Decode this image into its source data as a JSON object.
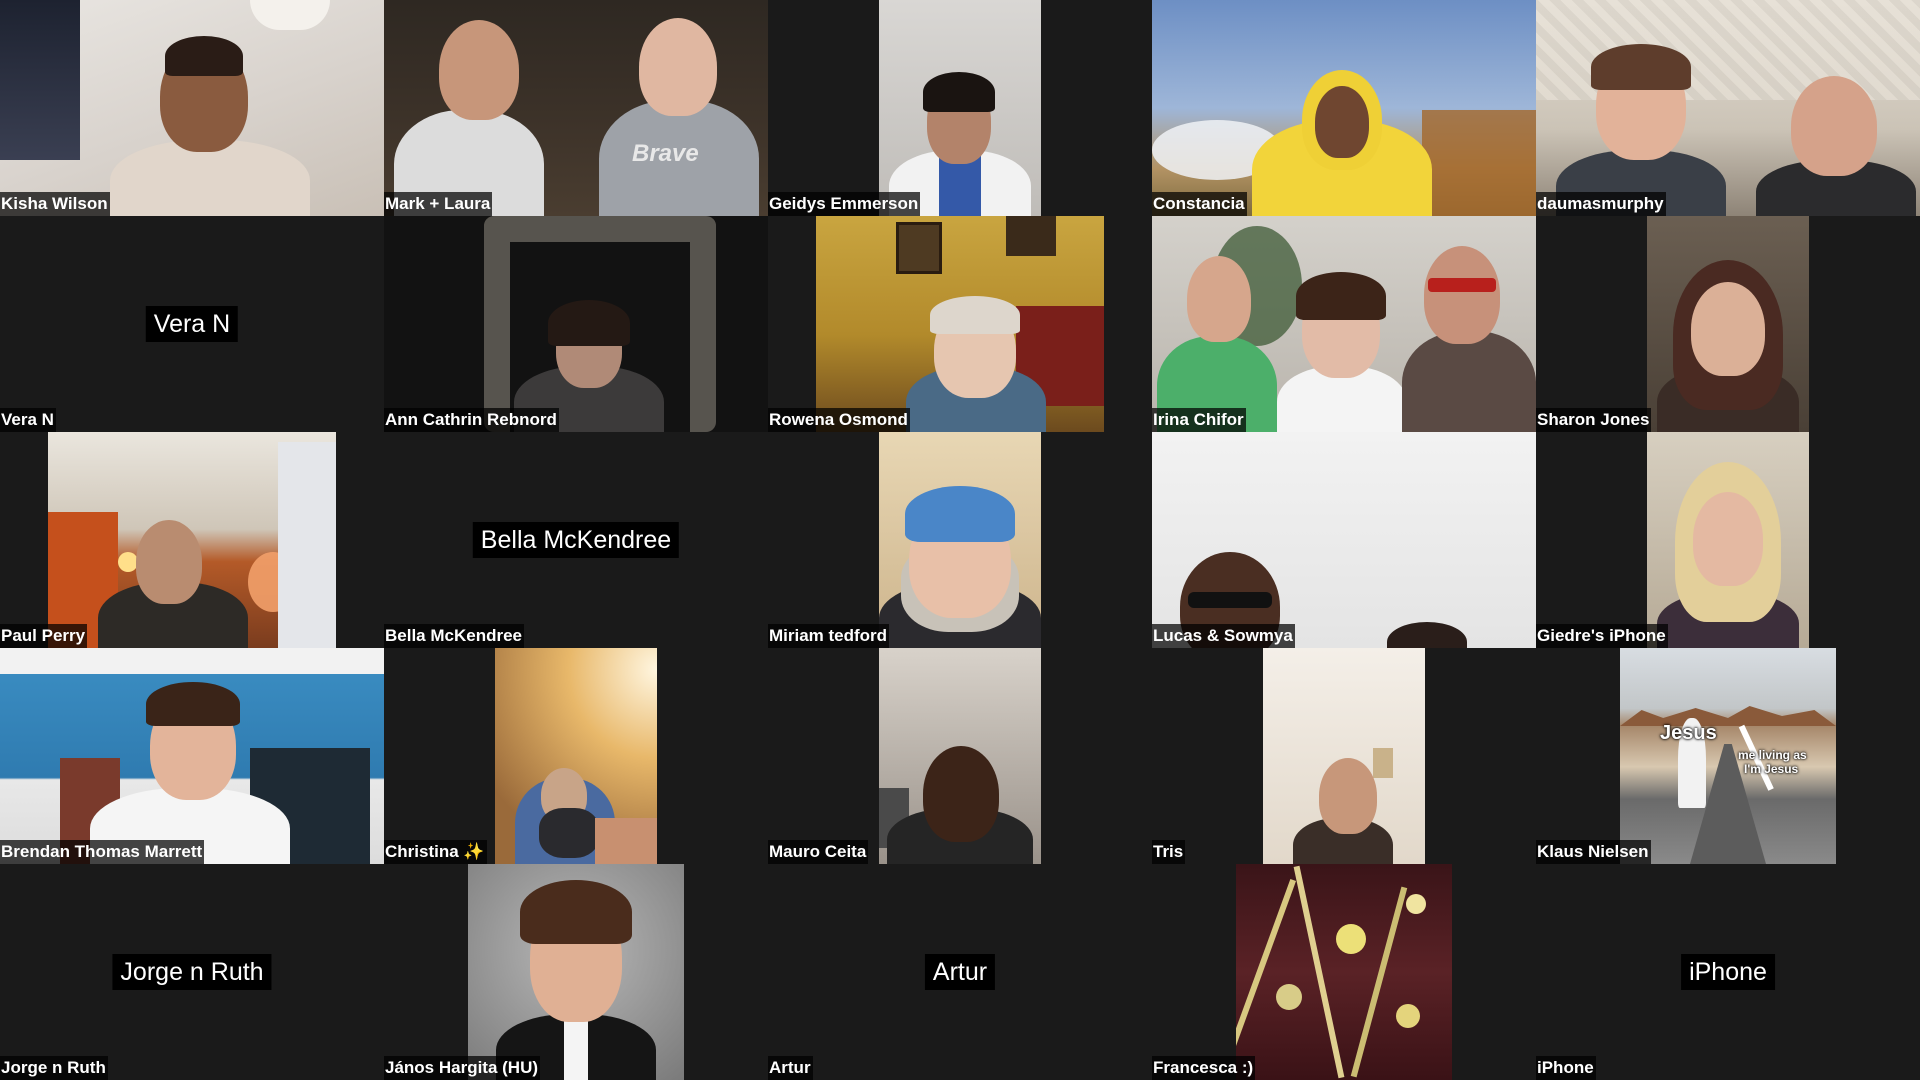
{
  "window": {
    "background": "#1a1a1a",
    "tag_background": "#000000",
    "text_color": "#ffffff"
  },
  "participants": [
    {
      "name": "Kisha Wilson",
      "video": true
    },
    {
      "name": "Mark + Laura",
      "video": true,
      "shirt_text": "Brave"
    },
    {
      "name": "Geidys Emmerson",
      "video": true
    },
    {
      "name": "Constancia",
      "video": true
    },
    {
      "name": "daumasmurphy",
      "video": true
    },
    {
      "name": "Vera N",
      "video": false
    },
    {
      "name": "Ann Cathrin Rebnord",
      "video": true
    },
    {
      "name": "Rowena Osmond",
      "video": true
    },
    {
      "name": "Irina Chifor",
      "video": true
    },
    {
      "name": "Sharon Jones",
      "video": true
    },
    {
      "name": "Paul Perry",
      "video": true
    },
    {
      "name": "Bella McKendree",
      "video": false
    },
    {
      "name": "Miriam tedford",
      "video": true
    },
    {
      "name": "Lucas & Sowmya",
      "video": true
    },
    {
      "name": "Giedre's iPhone",
      "video": true
    },
    {
      "name": "Brendan Thomas Marrett",
      "video": true
    },
    {
      "name": "Christina ✨",
      "video": true
    },
    {
      "name": "Mauro Ceita",
      "video": true
    },
    {
      "name": "Tris",
      "video": true
    },
    {
      "name": "Klaus Nielsen",
      "video": true,
      "overlay_title": "Jesus",
      "overlay_caption_1": "me living as",
      "overlay_caption_2": "I'm Jesus"
    },
    {
      "name": "Jorge n Ruth",
      "video": false
    },
    {
      "name": "János Hargita (HU)",
      "video": true
    },
    {
      "name": "Artur",
      "video": false
    },
    {
      "name": "Francesca :)",
      "video": true
    },
    {
      "name": "iPhone",
      "video": false
    }
  ]
}
